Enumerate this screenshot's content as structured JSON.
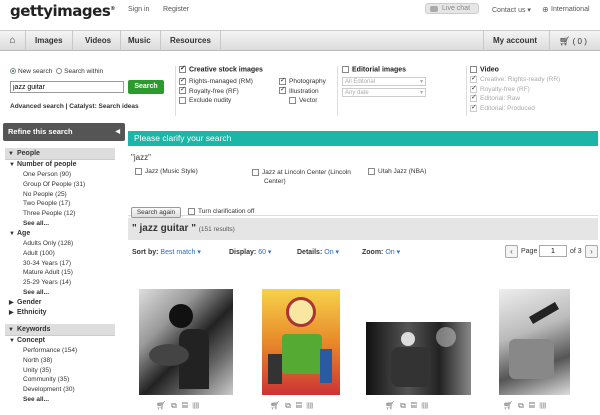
{
  "header": {
    "logo": "gettyimages",
    "logo_mark": "®",
    "sign_in": "Sign in",
    "register": "Register",
    "live_chat": "Live chat",
    "contact_us": "Contact us ▾",
    "international": "International"
  },
  "nav": {
    "items": [
      "Images",
      "Videos",
      "Music",
      "Resources"
    ],
    "my_account": "My account",
    "cart_count": "( 0 )"
  },
  "search": {
    "new_search": "New search",
    "search_within": "Search within",
    "query": "jazz guitar",
    "button": "Search",
    "advanced": "Advanced search",
    "catalyst": "Catalyst: Search ideas"
  },
  "creative": {
    "title": "Creative stock images",
    "col1": [
      "Rights-managed (RM)",
      "Royalty-free (RF)",
      "Exclude nudity"
    ],
    "col2": [
      "Photography",
      "Illustration",
      "Vector"
    ]
  },
  "editorial": {
    "title": "Editorial images",
    "select1": "All Editorial",
    "select2": "Any date"
  },
  "video": {
    "title": "Video",
    "items": [
      "Creative: Rights-ready (RR)",
      "Royalty-free (RF)",
      "Editorial: Raw",
      "Editorial: Produced"
    ]
  },
  "refine": {
    "title": "Refine this search",
    "people_header": "People",
    "number_of_people": "Number of people",
    "number_items": [
      "One Person (90)",
      "Group Of People (31)",
      "No People (25)",
      "Two People (17)",
      "Three People (12)"
    ],
    "see_all": "See all...",
    "age": "Age",
    "age_items": [
      "Adults Only (126)",
      "Adult (100)",
      "30-34 Years (17)",
      "Mature Adult (15)",
      "25-29 Years (14)"
    ],
    "gender": "Gender",
    "ethnicity": "Ethnicity",
    "keywords_header": "Keywords",
    "concept": "Concept",
    "concept_items": [
      "Performance (154)",
      "North (38)",
      "Unity (35)",
      "Community (35)",
      "Development (30)"
    ]
  },
  "clarify": {
    "title": "Please clarify your search",
    "term": "\"jazz\"",
    "options": [
      "Jazz (Music Style)",
      "Jazz at Lincoln Center (Lincoln Center)",
      "Utah Jazz (NBA)"
    ],
    "search_again": "Search again",
    "turn_off": "Turn clarification off"
  },
  "results": {
    "title": "\" jazz guitar \"",
    "count": "(151 results)",
    "sort_label": "Sort by:",
    "sort_value": "Best match ▾",
    "display_label": "Display:",
    "display_value": "60 ▾",
    "details_label": "Details:",
    "details_value": "On ▾",
    "zoom_label": "Zoom:",
    "zoom_value": "On ▾",
    "page_label": "Page",
    "page_value": "1",
    "page_total": "of 3"
  }
}
